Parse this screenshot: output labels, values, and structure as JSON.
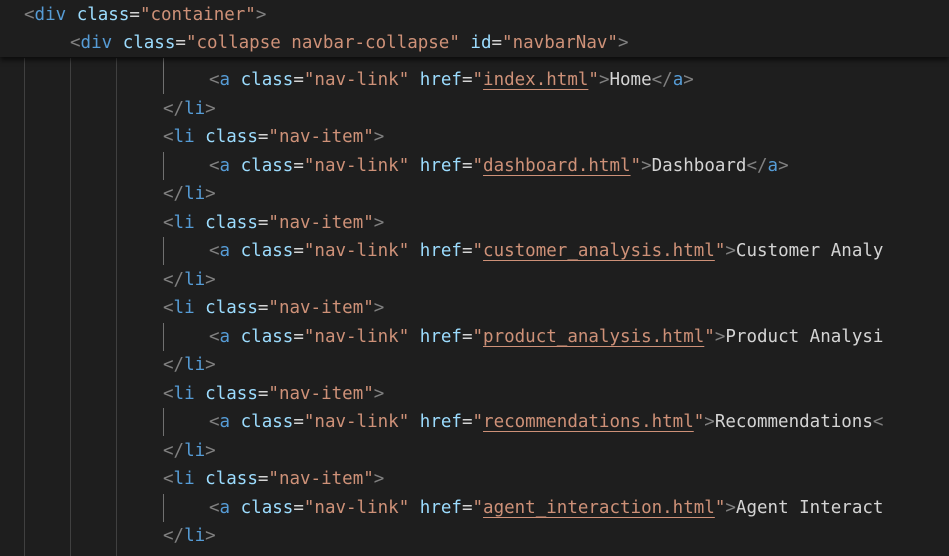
{
  "sticky_lines": [
    {
      "indent": "  ",
      "tag": "div",
      "attrs": [
        {
          "name": "class",
          "value": "container"
        }
      ]
    },
    {
      "indent": "      ",
      "tag": "div",
      "attrs": [
        {
          "name": "class",
          "value": "collapse navbar-collapse"
        },
        {
          "name": "id",
          "value": "navbarNav"
        }
      ]
    }
  ],
  "code_lines": [
    {
      "kind": "anchor",
      "href": "index.html",
      "text": "Home",
      "closing": true
    },
    {
      "kind": "close_li"
    },
    {
      "kind": "open_li",
      "class": "nav-item"
    },
    {
      "kind": "anchor",
      "href": "dashboard.html",
      "text": "Dashboard",
      "closing": true
    },
    {
      "kind": "close_li"
    },
    {
      "kind": "open_li",
      "class": "nav-item"
    },
    {
      "kind": "anchor",
      "href": "customer_analysis.html",
      "text": "Customer Analy",
      "closing": false
    },
    {
      "kind": "close_li"
    },
    {
      "kind": "open_li",
      "class": "nav-item"
    },
    {
      "kind": "anchor",
      "href": "product_analysis.html",
      "text": "Product Analysi",
      "closing": false
    },
    {
      "kind": "close_li"
    },
    {
      "kind": "open_li",
      "class": "nav-item"
    },
    {
      "kind": "anchor",
      "href": "recommendations.html",
      "text": "Recommendations",
      "closing": false,
      "trailing": "<"
    },
    {
      "kind": "close_li"
    },
    {
      "kind": "open_li",
      "class": "nav-item"
    },
    {
      "kind": "anchor",
      "href": "agent_interaction.html",
      "text": "Agent Interact",
      "closing": false
    },
    {
      "kind": "close_li"
    }
  ],
  "anchor_tag": "a",
  "anchor_class": "nav-link",
  "li_tag": "li",
  "colors": {
    "background": "#1e1e1e",
    "bracket": "#808080",
    "tag": "#569cd6",
    "attribute": "#9cdcfe",
    "string": "#ce9178",
    "text": "#d4d4d4"
  }
}
